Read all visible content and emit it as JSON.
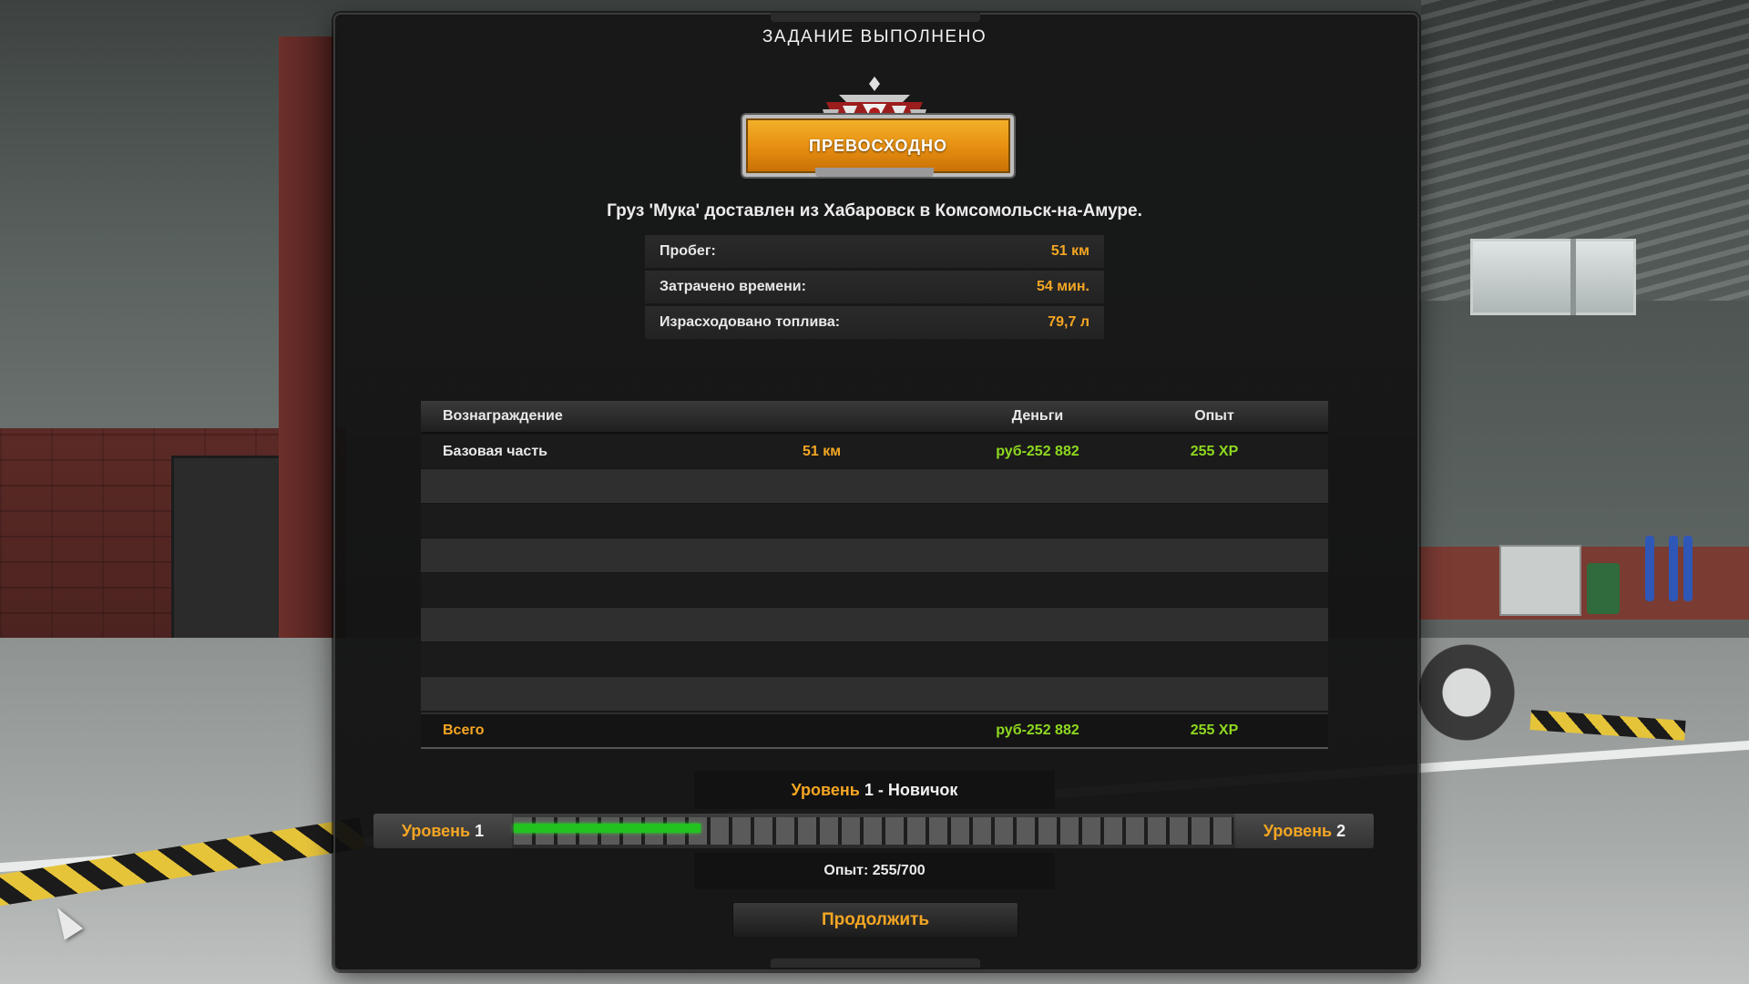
{
  "title": "ЗАДАНИЕ ВЫПОЛНЕНО",
  "rating": {
    "label": "ПРЕВОСХОДНО",
    "color": "#e58d10"
  },
  "cargo_line": "Груз 'Мука' доставлен из Хабаровск в Комсомольск-на-Амуре.",
  "stats": [
    {
      "label": "Пробег:",
      "value": "51 км"
    },
    {
      "label": "Затрачено времени:",
      "value": "54 мин."
    },
    {
      "label": "Израсходовано топлива:",
      "value": "79,7 л"
    }
  ],
  "rewards": {
    "headers": {
      "label": "Вознаграждение",
      "money": "Деньги",
      "xp": "Опыт"
    },
    "rows": [
      {
        "label": "Базовая часть",
        "distance": "51 км",
        "money": "руб-252 882",
        "xp": "255 XP"
      }
    ],
    "total": {
      "label": "Всего",
      "money": "руб-252 882",
      "xp": "255 XP"
    }
  },
  "level": {
    "word": "Уровень",
    "current": "1",
    "rank": " - Новичок",
    "next": "2",
    "xp_label": "Опыт: 255/700",
    "progress": 0.364,
    "bar_color": "#22c31f"
  },
  "continue_label": "Продолжить",
  "colors": {
    "accent": "#f5a623",
    "positive": "#8ed81f"
  }
}
